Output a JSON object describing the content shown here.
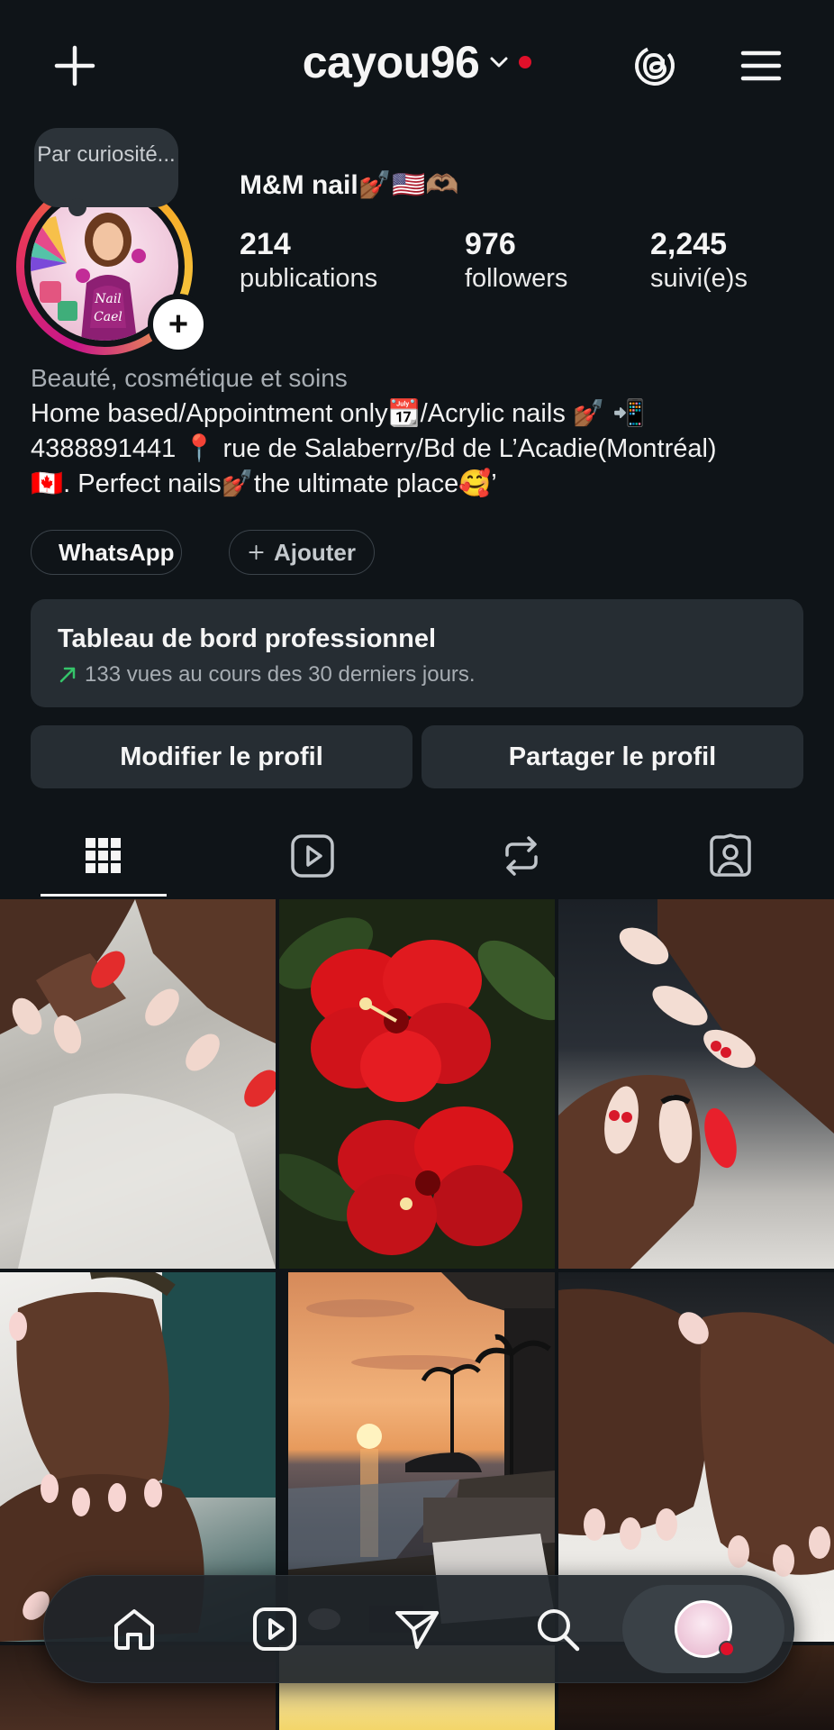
{
  "header": {
    "username": "cayou96",
    "new_post_icon": "plus-icon",
    "threads_icon": "threads-icon",
    "menu_icon": "hamburger-menu-icon"
  },
  "profile": {
    "note": "Par curiosité...",
    "display_name": "M&M nail💅🏾🇺🇸🫶🏽",
    "stats": {
      "posts_count": "214",
      "posts_label": "publications",
      "followers_count": "976",
      "followers_label": "followers",
      "following_count": "2,245",
      "following_label": "suivi(e)s"
    },
    "category": "Beauté, cosmétique et soins",
    "bio_line1": "Home based/Appointment only📆/Acrylic nails 💅🏾 📲",
    "bio_line2": "4388891441 📍 rue de Salaberry/Bd de L’Acadie(Montréal)",
    "bio_line3": "🇨🇦. Perfect nails💅🏾the ultimate place🥰’",
    "chips": {
      "whatsapp_label": "WhatsApp",
      "add_label": "Ajouter"
    },
    "dashboard": {
      "title": "Tableau de bord professionnel",
      "subtitle": "133 vues au cours des 30 derniers jours."
    },
    "buttons": {
      "edit_label": "Modifier le profil",
      "share_label": "Partager le profil"
    }
  },
  "tabs": [
    "grid-icon",
    "reels-icon",
    "reposts-icon",
    "tagged-icon"
  ],
  "grid": [
    "nails-photo-1",
    "hibiscus-photo",
    "nails-photo-2",
    "nails-photo-3",
    "sunset-photo",
    "nails-photo-4"
  ],
  "bottom_nav": [
    "home-icon",
    "reels-icon",
    "direct-icon",
    "search-icon",
    "profile-avatar"
  ],
  "colors": {
    "background": "#0f1418",
    "card": "#262d33",
    "accent_red": "#e0102a",
    "trend_green": "#35c46a",
    "muted_text": "#a7adb3"
  }
}
